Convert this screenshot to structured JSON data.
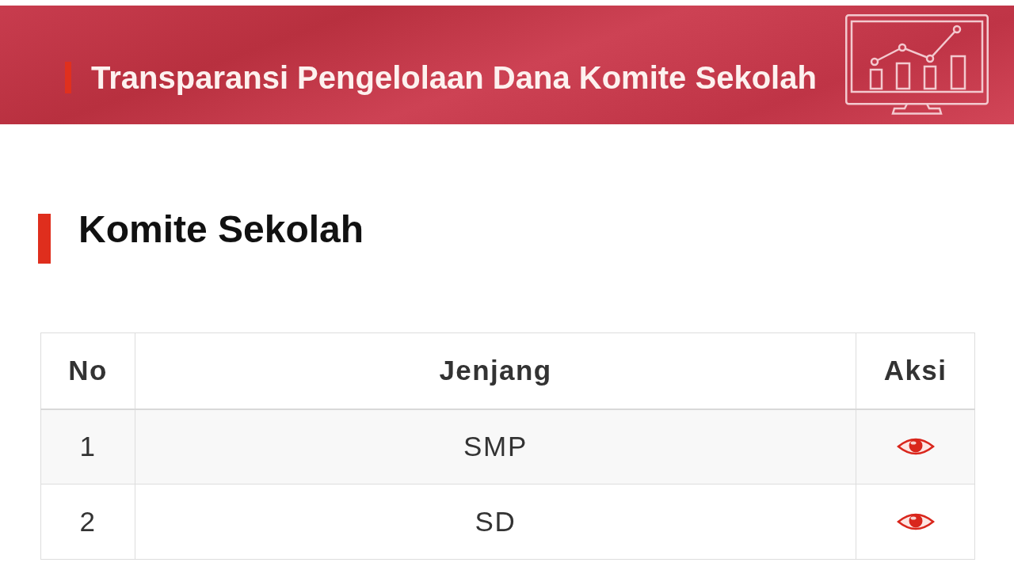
{
  "banner": {
    "title": "Transparansi Pengelolaan Dana Komite Sekolah"
  },
  "section": {
    "heading": "Komite Sekolah"
  },
  "table": {
    "columns": [
      "No",
      "Jenjang",
      "Aksi"
    ],
    "rows": [
      {
        "no": "1",
        "jenjang": "SMP"
      },
      {
        "no": "2",
        "jenjang": "SD"
      }
    ]
  }
}
